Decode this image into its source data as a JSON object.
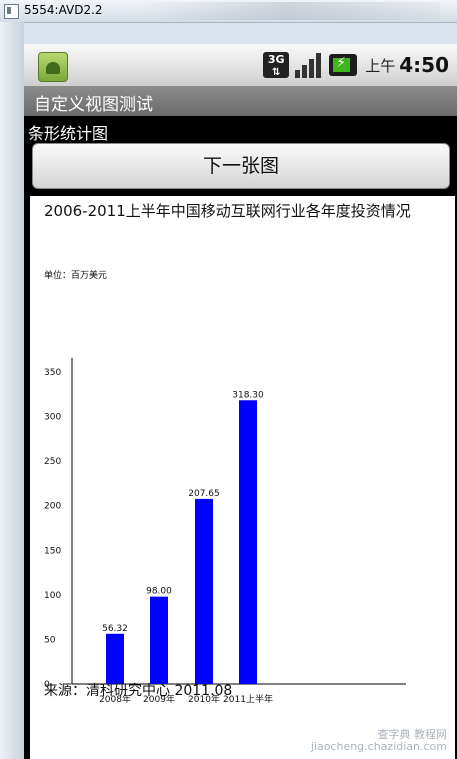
{
  "window": {
    "title": "5554:AVD2.2"
  },
  "statusbar": {
    "network_label": "3G",
    "time_prefix": "上午",
    "time": "4:50",
    "icons": [
      "app-icon",
      "3g-icon",
      "signal-icon",
      "battery-charging-icon"
    ],
    "colors": {
      "battery": "#3fb51f"
    }
  },
  "app": {
    "title": "自定义视图测试",
    "subtitle": "条形统计图",
    "next_button": "下一张图"
  },
  "chart": {
    "title": "2006-2011上半年中国移动互联网行业各年度投资情况",
    "unit_label": "单位：百万美元",
    "source": "来源：清科研究中心 2011.08"
  },
  "chart_data": {
    "type": "bar",
    "title": "2006-2011上半年中国移动互联网行业各年度投资情况",
    "categories": [
      "2008年",
      "2009年",
      "2010年",
      "2011上半年"
    ],
    "values": [
      56.32,
      98.0,
      207.65,
      318.3
    ],
    "value_labels": [
      "56.32",
      "98.00",
      "207.65",
      "318.30"
    ],
    "y_ticks": [
      0,
      50,
      100,
      150,
      200,
      250,
      300,
      350
    ],
    "ylim": [
      0,
      350
    ],
    "bar_color": "#0000ff",
    "grid": false,
    "legend": "none"
  },
  "watermark": {
    "line1": "查字典 教程网",
    "line2": "jiaocheng.chazidian.com"
  }
}
